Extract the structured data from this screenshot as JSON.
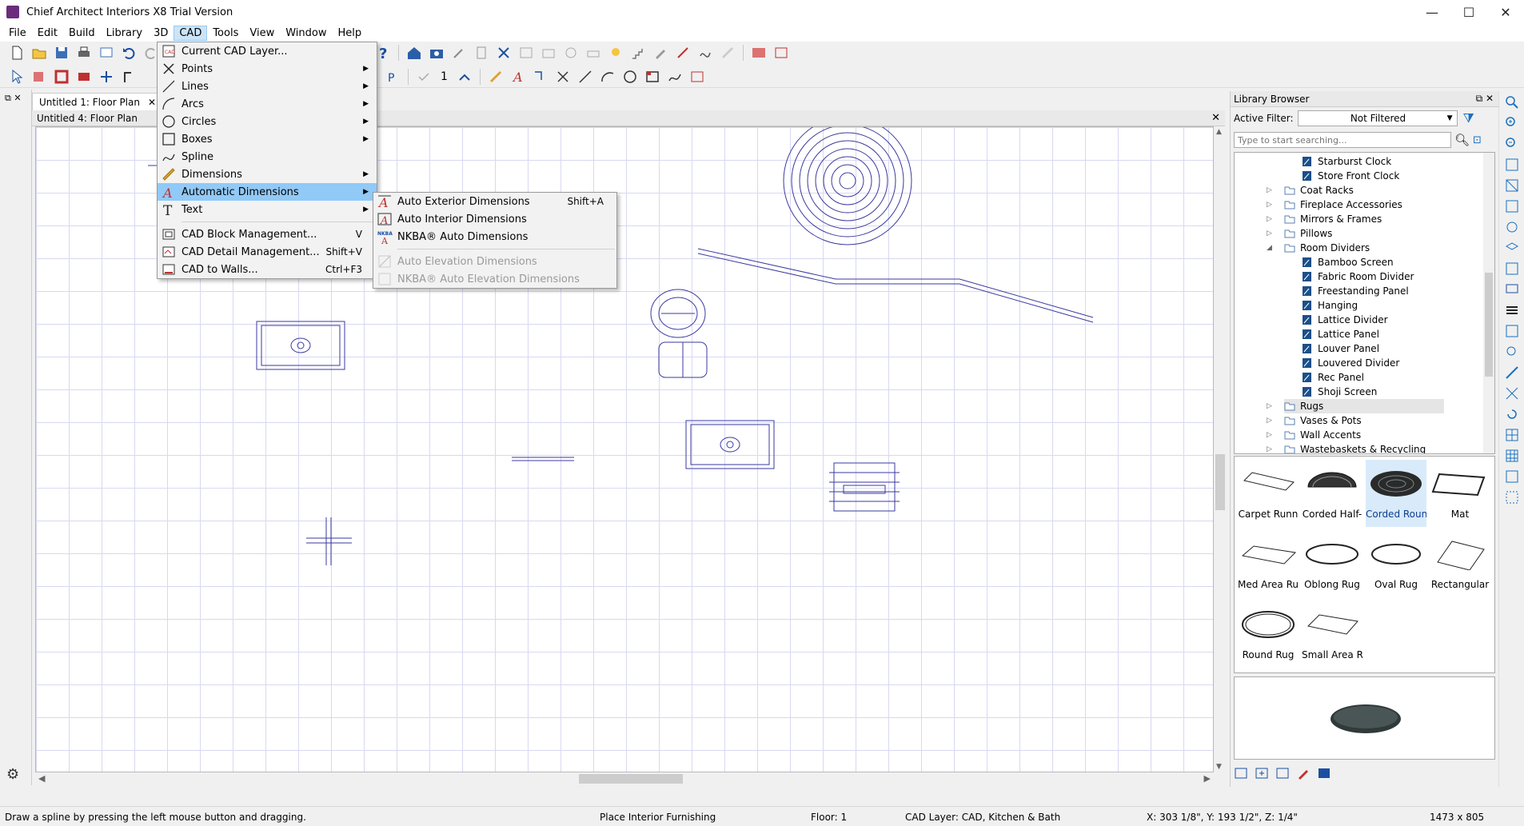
{
  "window": {
    "title": "Chief Architect Interiors X8 Trial Version",
    "minimize": "—",
    "maximize": "☐",
    "close": "✕"
  },
  "menubar": [
    "File",
    "Edit",
    "Build",
    "Library",
    "3D",
    "CAD",
    "Tools",
    "View",
    "Window",
    "Help"
  ],
  "active_menu": "CAD",
  "toolbar2_number": "1",
  "left_panel": {
    "controls": "⧉ ✕"
  },
  "doc_tabs": [
    {
      "label": "Untitled 1: Floor Plan",
      "close": "✕"
    }
  ],
  "active_view_title": "Untitled 4: Floor Plan",
  "active_view_close": "✕",
  "cad_menu": {
    "items": [
      {
        "label": "Current CAD Layer...",
        "shortcut": "",
        "submenu": false,
        "icon": "cad-layer-icon"
      },
      {
        "label": "Points",
        "shortcut": "",
        "submenu": true,
        "icon": "points-icon"
      },
      {
        "label": "Lines",
        "shortcut": "",
        "submenu": true,
        "icon": "lines-icon"
      },
      {
        "label": "Arcs",
        "shortcut": "",
        "submenu": true,
        "icon": "arcs-icon"
      },
      {
        "label": "Circles",
        "shortcut": "",
        "submenu": true,
        "icon": "circles-icon"
      },
      {
        "label": "Boxes",
        "shortcut": "",
        "submenu": true,
        "icon": "boxes-icon"
      },
      {
        "label": "Spline",
        "shortcut": "",
        "submenu": false,
        "icon": "spline-icon"
      },
      {
        "label": "Dimensions",
        "shortcut": "",
        "submenu": true,
        "icon": "dimensions-icon"
      },
      {
        "label": "Automatic Dimensions",
        "shortcut": "",
        "submenu": true,
        "icon": "auto-dimensions-icon",
        "highlighted": true
      },
      {
        "label": "Text",
        "shortcut": "",
        "submenu": true,
        "icon": "text-icon"
      },
      {
        "label": "CAD Block Management...",
        "shortcut": "V",
        "submenu": false,
        "icon": "cad-block-icon"
      },
      {
        "label": "CAD Detail Management...",
        "shortcut": "Shift+V",
        "submenu": false,
        "icon": "cad-detail-icon"
      },
      {
        "label": "CAD to Walls...",
        "shortcut": "Ctrl+F3",
        "submenu": false,
        "icon": "cad-to-walls-icon"
      }
    ]
  },
  "auto_dim_submenu": {
    "items": [
      {
        "label": "Auto Exterior Dimensions",
        "shortcut": "Shift+A",
        "enabled": true
      },
      {
        "label": "Auto Interior Dimensions",
        "shortcut": "",
        "enabled": true
      },
      {
        "label": "NKBA® Auto Dimensions",
        "shortcut": "",
        "enabled": true
      },
      {
        "label": "Auto Elevation Dimensions",
        "shortcut": "",
        "enabled": false
      },
      {
        "label": "NKBA® Auto Elevation Dimensions",
        "shortcut": "",
        "enabled": false
      }
    ]
  },
  "library": {
    "title": "Library Browser",
    "title_controls": "⧉ ✕",
    "filter_label": "Active Filter:",
    "filter_value": "Not Filtered",
    "search_placeholder": "Type to start searching...",
    "tree": [
      {
        "label": "Starburst Clock",
        "level": 2,
        "type": "item"
      },
      {
        "label": "Store Front Clock",
        "level": 2,
        "type": "item"
      },
      {
        "label": "Coat Racks",
        "level": 1,
        "type": "folder",
        "expander": "▷"
      },
      {
        "label": "Fireplace Accessories",
        "level": 1,
        "type": "folder",
        "expander": "▷"
      },
      {
        "label": "Mirrors & Frames",
        "level": 1,
        "type": "folder",
        "expander": "▷"
      },
      {
        "label": "Pillows",
        "level": 1,
        "type": "folder",
        "expander": "▷"
      },
      {
        "label": "Room Dividers",
        "level": 1,
        "type": "folder",
        "expander": "◢"
      },
      {
        "label": "Bamboo Screen",
        "level": 2,
        "type": "item"
      },
      {
        "label": "Fabric Room Divider",
        "level": 2,
        "type": "item"
      },
      {
        "label": "Freestanding Panel",
        "level": 2,
        "type": "item"
      },
      {
        "label": "Hanging",
        "level": 2,
        "type": "item"
      },
      {
        "label": "Lattice Divider",
        "level": 2,
        "type": "item"
      },
      {
        "label": "Lattice Panel",
        "level": 2,
        "type": "item"
      },
      {
        "label": "Louver Panel",
        "level": 2,
        "type": "item"
      },
      {
        "label": "Louvered Divider",
        "level": 2,
        "type": "item"
      },
      {
        "label": "Rec Panel",
        "level": 2,
        "type": "item"
      },
      {
        "label": "Shoji Screen",
        "level": 2,
        "type": "item"
      },
      {
        "label": "Rugs",
        "level": 1,
        "type": "folder",
        "expander": "▷",
        "selected": true
      },
      {
        "label": "Vases & Pots",
        "level": 1,
        "type": "folder",
        "expander": "▷"
      },
      {
        "label": "Wall Accents",
        "level": 1,
        "type": "folder",
        "expander": "▷"
      },
      {
        "label": "Wastebaskets & Recycling",
        "level": 1,
        "type": "folder",
        "expander": "▷"
      }
    ],
    "thumbnails": [
      {
        "label": "Carpet Runn",
        "shape": "runner"
      },
      {
        "label": "Corded Half-",
        "shape": "half"
      },
      {
        "label": "Corded Roun",
        "shape": "round-corded",
        "selected": true
      },
      {
        "label": "Mat",
        "shape": "mat"
      },
      {
        "label": "Med Area Ru",
        "shape": "area"
      },
      {
        "label": "Oblong Rug",
        "shape": "oblong"
      },
      {
        "label": "Oval Rug",
        "shape": "oval"
      },
      {
        "label": "Rectangular",
        "shape": "rect"
      },
      {
        "label": "Round Rug",
        "shape": "round"
      },
      {
        "label": "Small Area R",
        "shape": "small"
      }
    ]
  },
  "statusbar": {
    "hint": "Draw a spline by pressing the left mouse button and dragging.",
    "mode": "Place Interior Furnishing",
    "floor": "Floor: 1",
    "layer": "CAD Layer:  CAD, Kitchen & Bath",
    "coords": "X: 303 1/8\", Y: 193 1/2\", Z: 1/4\"",
    "size": "1473 x 805"
  },
  "colors": {
    "cad_line": "#3a3aa0",
    "menu_highlight": "#91c9f7",
    "grid": "#d8d8f2",
    "selected_thumb": "#d9ebfa"
  }
}
